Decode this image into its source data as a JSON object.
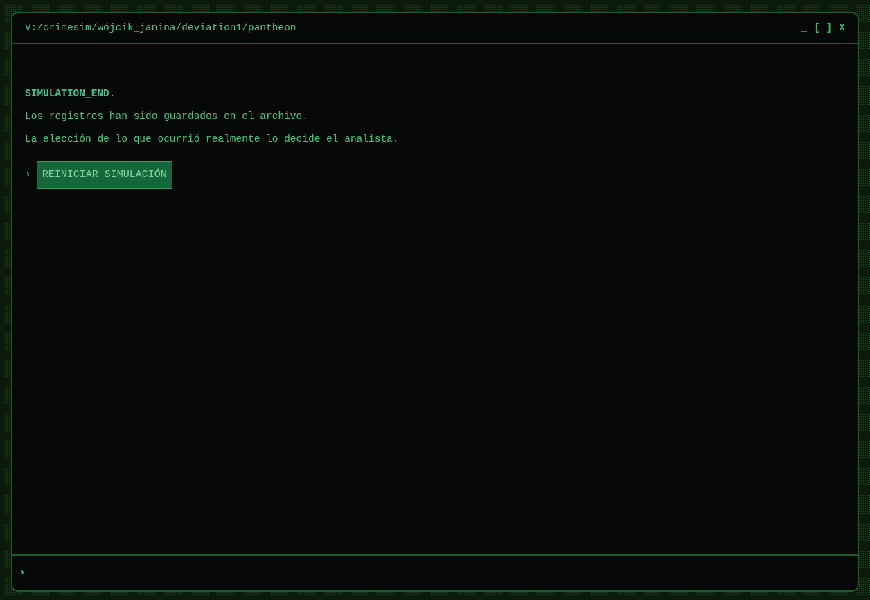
{
  "window": {
    "title": "V:/crimesim/wójcik_janina/deviation1/pantheon",
    "controls": [
      "_",
      "[ ]",
      "X"
    ]
  },
  "output": {
    "lines": [
      {
        "kind": "heading",
        "text": "SIMULATION_END."
      },
      {
        "kind": "plain",
        "text": "Los registros han sido guardados en el archivo."
      },
      {
        "kind": "plain",
        "text": "La elección de lo que ocurrió realmente lo decide el analista."
      }
    ],
    "choices": [
      {
        "prompt": "›",
        "label": "REINICIAR SIMULACIÓN"
      }
    ]
  },
  "input_bar": {
    "prompt": "›",
    "cursor": "_"
  }
}
